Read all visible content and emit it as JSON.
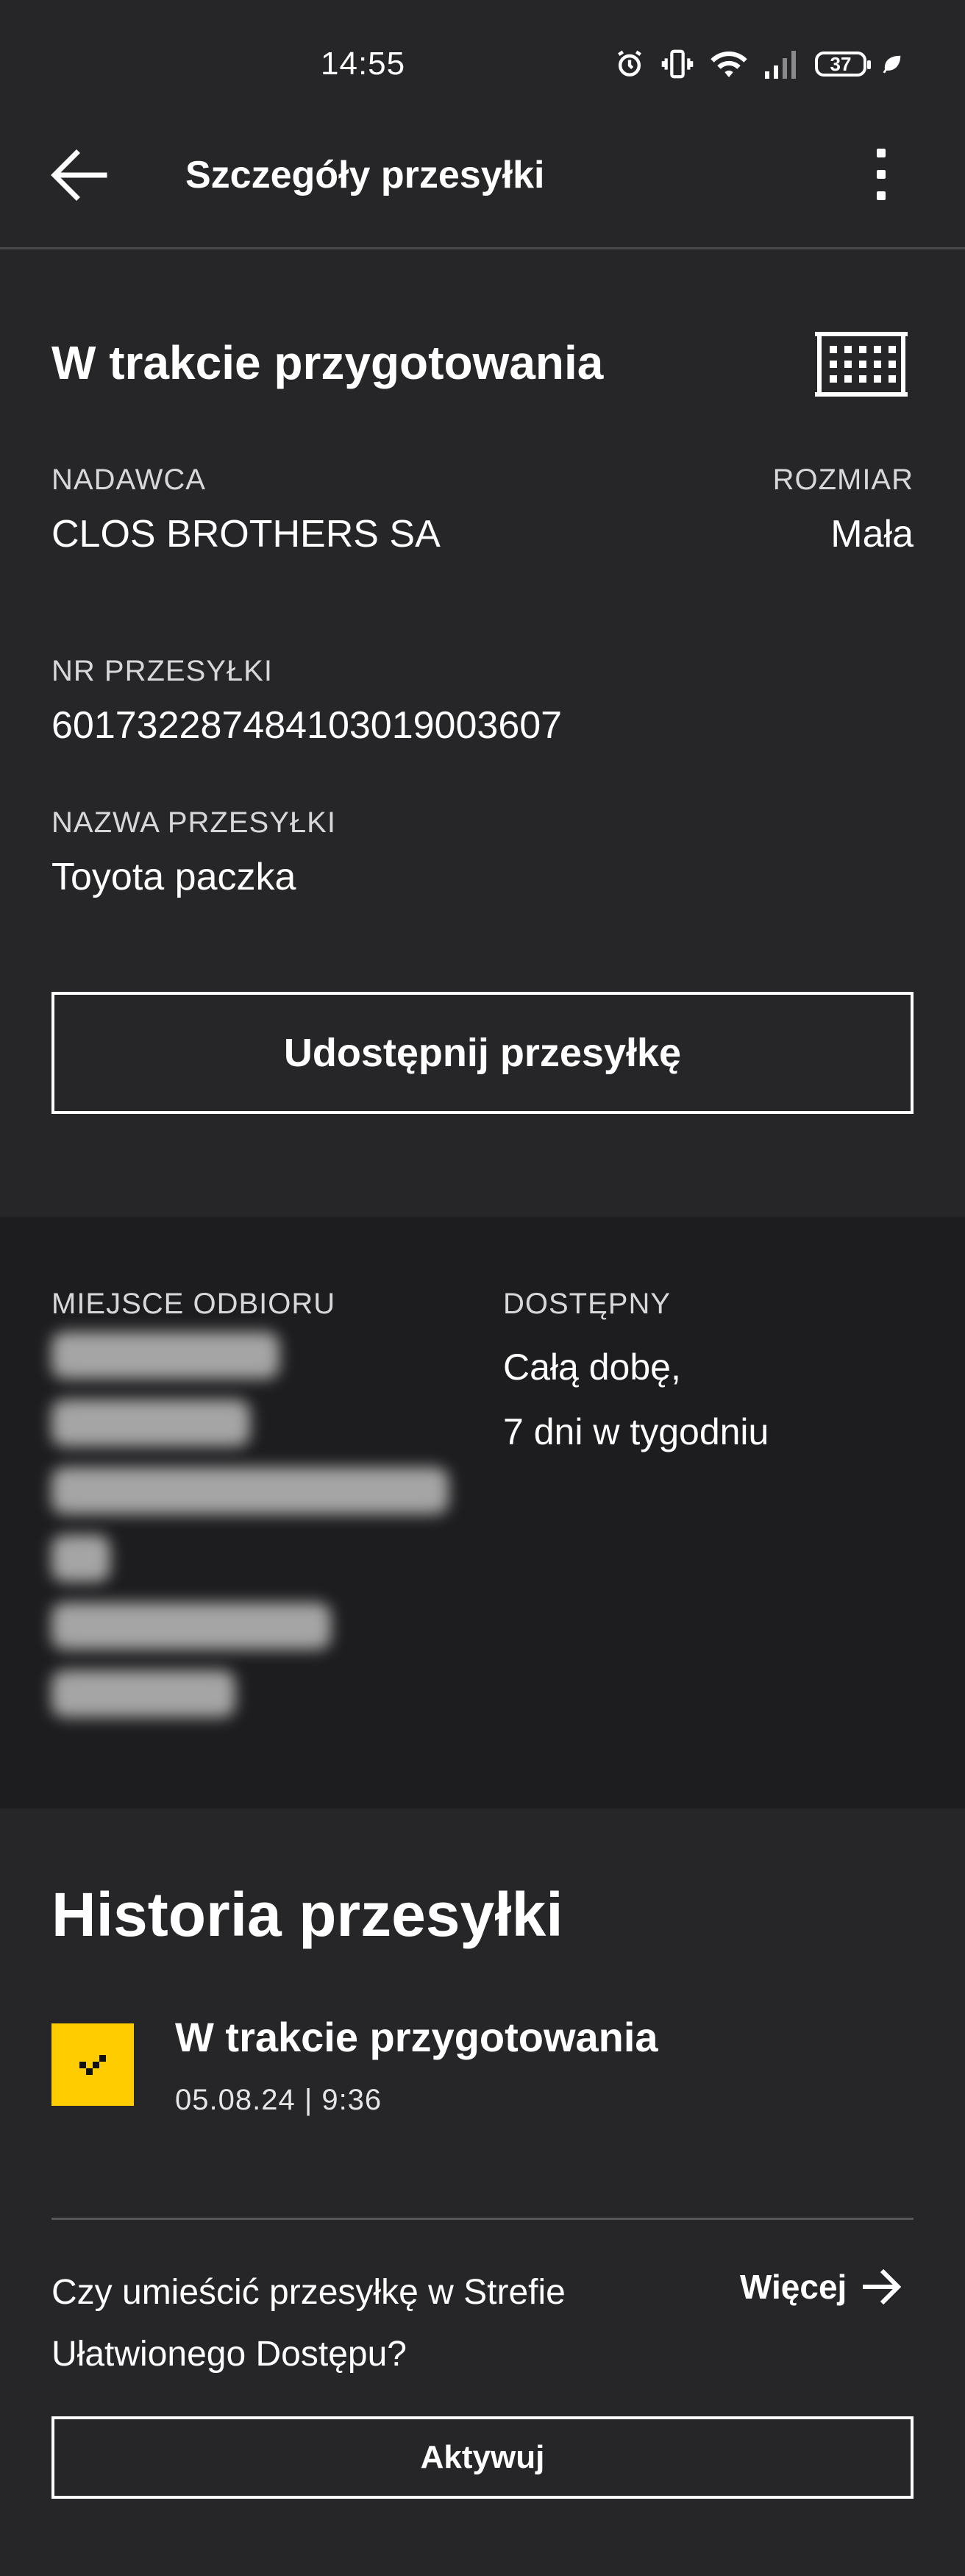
{
  "status_bar": {
    "time": "14:55",
    "battery": "37",
    "icons": [
      "alarm-icon",
      "vibrate-icon",
      "wifi-icon",
      "signal-icon",
      "battery-icon",
      "leaf-icon"
    ]
  },
  "app_bar": {
    "title": "Szczegóły przesyłki",
    "back_icon": "arrow-left-icon",
    "menu_icon": "more-vertical-icon"
  },
  "shipment": {
    "status": "W trakcie przygotowania",
    "status_icon": "parcel-locker-icon",
    "sender_label": "NADAWCA",
    "sender": "CLOS BROTHERS SA",
    "size_label": "ROZMIAR",
    "size": "Mała",
    "number_label": "NR PRZESYŁKI",
    "number": "601732287484103019003607",
    "name_label": "NAZWA PRZESYŁKI",
    "name": "Toyota paczka",
    "share_button": "Udostępnij przesyłkę"
  },
  "pickup": {
    "place_label": "MIEJSCE ODBIORU",
    "availability_label": "DOSTĘPNY",
    "availability_line1": "Całą dobę,",
    "availability_line2": "7 dni w tygodniu"
  },
  "history": {
    "title": "Historia przesyłki",
    "items": [
      {
        "status": "W trakcie przygotowania",
        "date": "05.08.24 | 9:36",
        "icon": "check-icon"
      }
    ]
  },
  "easy_access": {
    "question": "Czy umieścić przesyłkę w Strefie Ułatwionego Dostępu?",
    "more_label": "Więcej",
    "more_icon": "arrow-right-icon",
    "activate_button": "Aktywuj"
  },
  "colors": {
    "background": "#262628",
    "pickup_background": "#1d1d1f",
    "accent": "#ffcc00",
    "text": "#ffffff"
  }
}
